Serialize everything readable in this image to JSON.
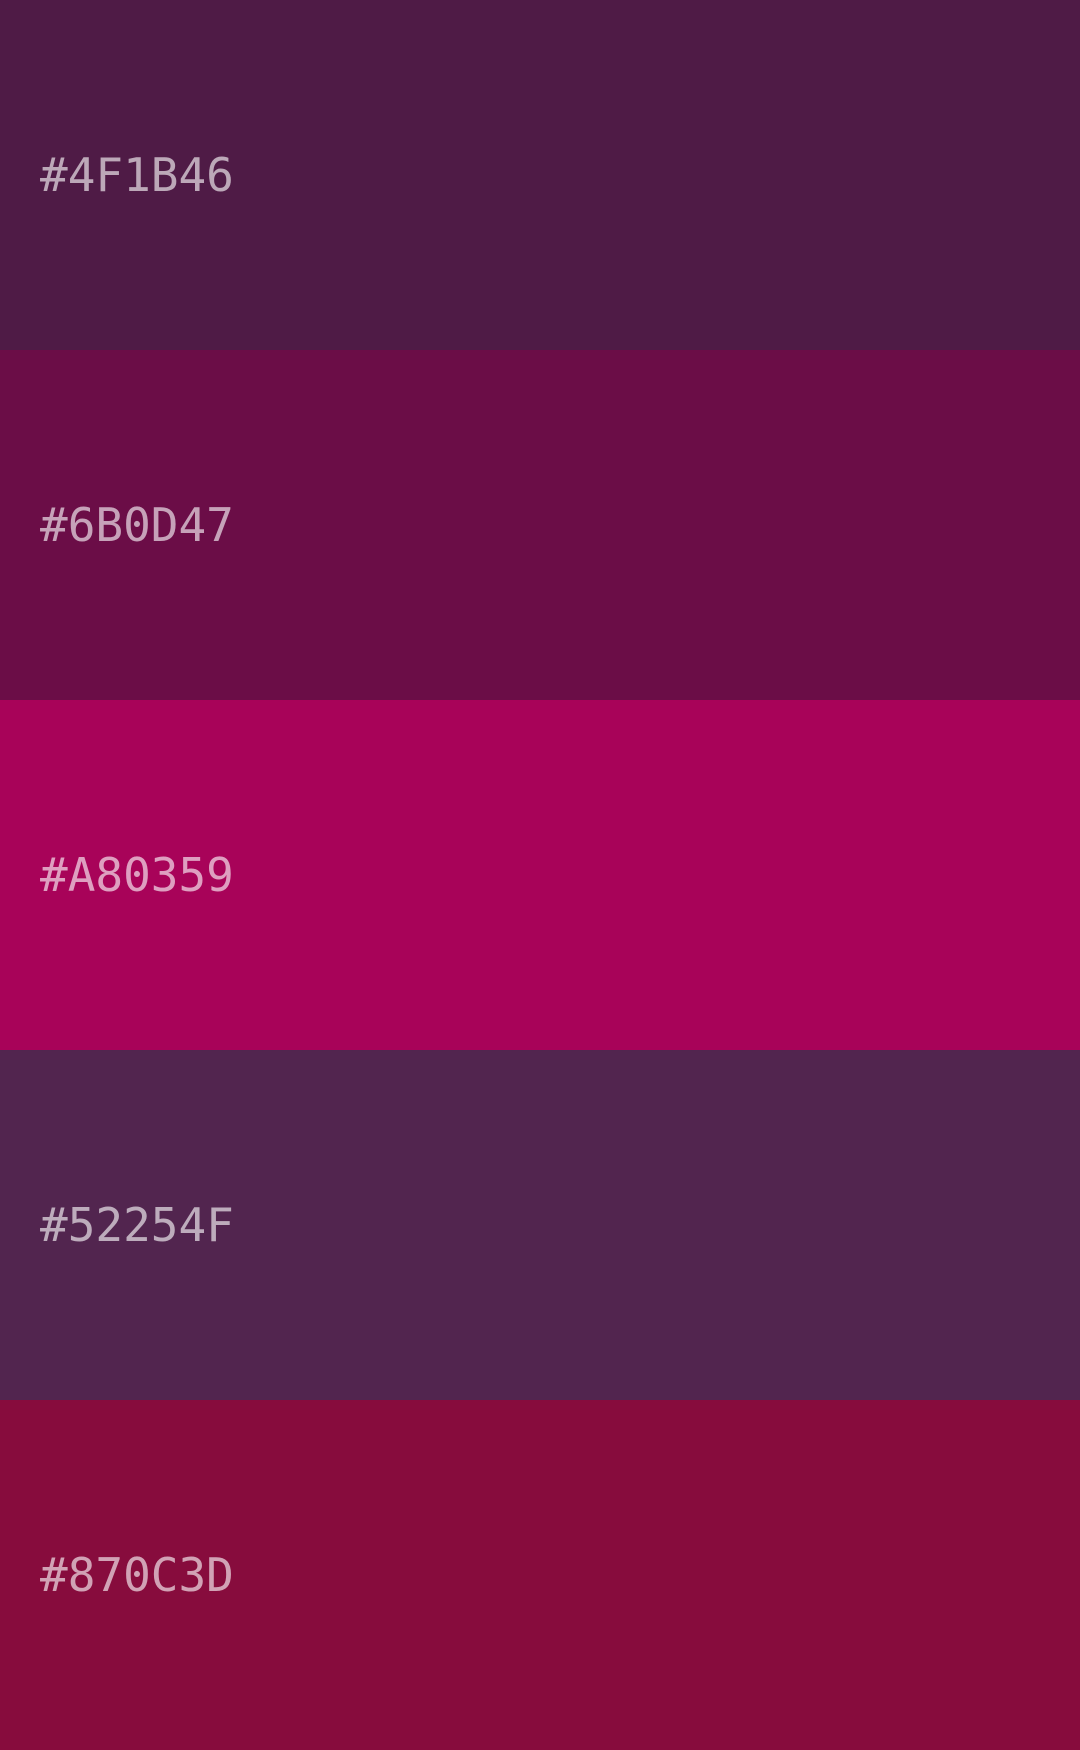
{
  "palette": {
    "swatches": [
      {
        "label": "#4F1B46",
        "color": "#4F1B46"
      },
      {
        "label": "#6B0D47",
        "color": "#6B0D47"
      },
      {
        "label": "#A80359",
        "color": "#A80359"
      },
      {
        "label": "#52254F",
        "color": "#52254F"
      },
      {
        "label": "#870C3D",
        "color": "#870C3D"
      }
    ]
  }
}
